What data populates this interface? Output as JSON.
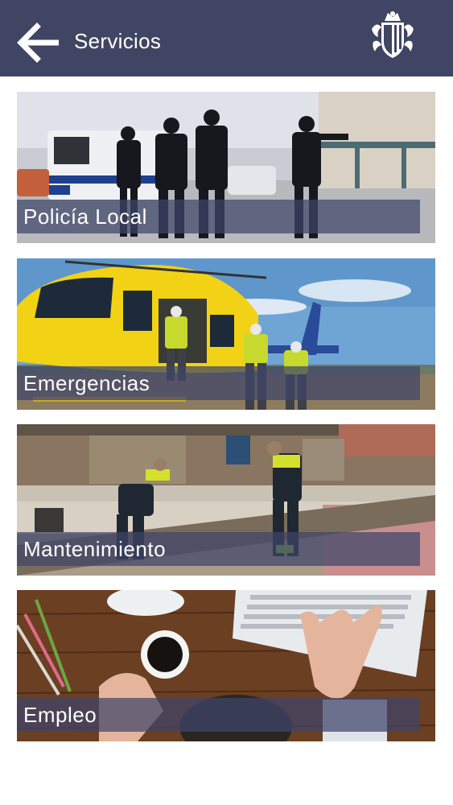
{
  "header": {
    "title": "Servicios",
    "back_icon": "arrow-left-icon",
    "crest_icon": "coat-of-arms-icon",
    "background": "#3f4562"
  },
  "services": [
    {
      "label": "Policía Local",
      "image": "police-officers-photo"
    },
    {
      "label": "Emergencias",
      "image": "rescue-helicopter-photo"
    },
    {
      "label": "Mantenimiento",
      "image": "street-maintenance-workers-photo"
    },
    {
      "label": "Empleo",
      "image": "desk-keyboard-coffee-photo"
    }
  ],
  "colors": {
    "label_band": "#3f4569",
    "text": "#ffffff"
  }
}
